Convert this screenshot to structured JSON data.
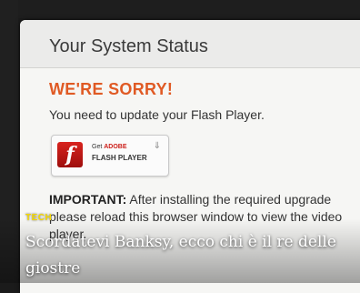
{
  "dialog": {
    "title": "Your System Status",
    "error_heading": "WE'RE SORRY!",
    "message": "You need to update your Flash Player.",
    "flash_button": {
      "line1_prefix": "Get",
      "line1_brand": "ADOBE",
      "line2": "FLASH PLAYER",
      "logo_glyph": "f"
    },
    "important_label": "IMPORTANT:",
    "important_text": " After installing the required upgrade please reload this browser window to view the video player."
  },
  "overlay": {
    "category": "TECH",
    "headline": "Scordatevi Banksy, ecco chi è il re delle giostre"
  },
  "colors": {
    "accent": "#e05a24",
    "flash_red": "#cc1f1a",
    "tag_yellow": "#f5d800"
  }
}
